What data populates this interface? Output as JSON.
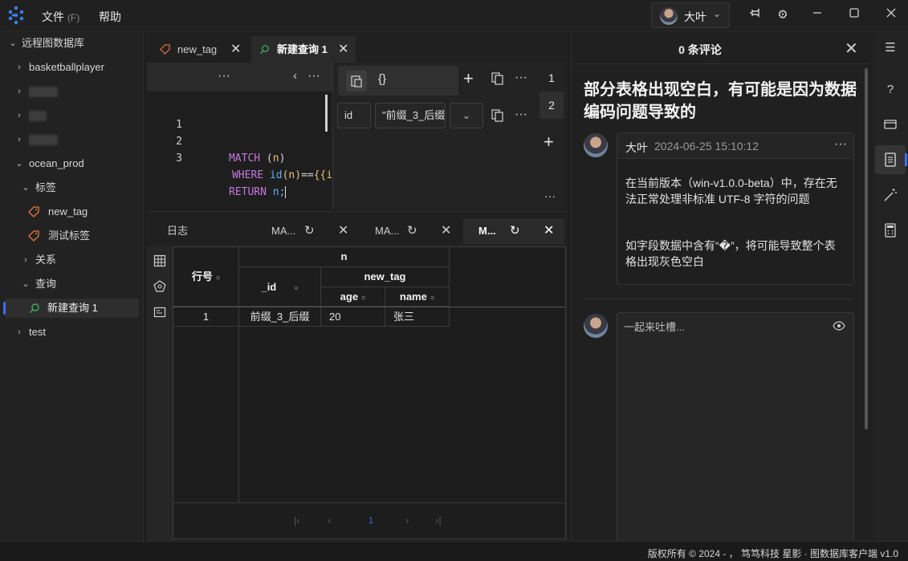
{
  "menu": {
    "file_label": "文件",
    "file_hint": "(F)",
    "help_label": "帮助"
  },
  "user": {
    "name": "大叶"
  },
  "sidebar": {
    "root": "远程图数据库",
    "db1": "basketballplayer",
    "db2": "ocean_prod",
    "tags_group": "标签",
    "tag1": "new_tag",
    "tag2": "测试标签",
    "rel_group": "关系",
    "query_group": "查询",
    "query1": "新建查询 1",
    "db3": "test"
  },
  "editor_tabs": [
    {
      "label": "new_tag"
    },
    {
      "label": "新建查询 1"
    }
  ],
  "code": {
    "lines": [
      {
        "num": "1",
        "kw": "MATCH",
        "rest1": " (",
        "v": "n",
        "rest2": ")"
      },
      {
        "num": "2",
        "kw": "WHERE",
        "fn": "id",
        "p1": "(n)",
        "op": "==",
        "p2": "{{id}}"
      },
      {
        "num": "3",
        "kw": "RETURN",
        "v": "n;"
      }
    ]
  },
  "params": {
    "braces": "{}",
    "key": "id",
    "value": "\"前缀_3_后缀",
    "page1": "1",
    "page2": "2"
  },
  "result_tabs": [
    {
      "label": "日志"
    },
    {
      "label": "MA..."
    },
    {
      "label": "MA..."
    },
    {
      "label": "M..."
    }
  ],
  "table": {
    "col_rownum": "行号",
    "col_group": "n",
    "col_id": "_id",
    "col_newtag": "new_tag",
    "col_age": "age",
    "col_name": "name",
    "rows": [
      {
        "num": "1",
        "id": "前缀_3_后缀",
        "age": "20",
        "name": "张三"
      }
    ],
    "page": "1"
  },
  "comments": {
    "count_title": "0 条评论",
    "issue_title": "部分表格出现空白，有可能是因为数据编码问题导致的",
    "author": "大叶",
    "time": "2024-06-25 15:10:12",
    "para1": "在当前版本（win-v1.0.0-beta）中，存在无法正常处理非标准 UTF-8 字符的问题",
    "para2": "如字段数据中含有“�”，将可能导致整个表格出现灰色空白",
    "placeholder": "一起来吐槽..."
  },
  "status": {
    "text": "版权所有 © 2024 - ， 笃笃科技  星影 · 图数据库客户端  v1.0"
  }
}
